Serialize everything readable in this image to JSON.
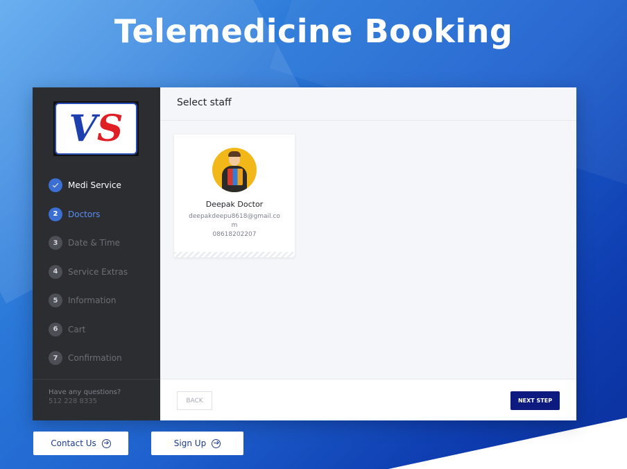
{
  "page": {
    "title": "Telemedicine Booking"
  },
  "logo": {
    "letters": "VS"
  },
  "sidebar": {
    "steps": [
      {
        "num": "1",
        "label": "Medi Service",
        "state": "done"
      },
      {
        "num": "2",
        "label": "Doctors",
        "state": "active"
      },
      {
        "num": "3",
        "label": "Date & Time",
        "state": "pending"
      },
      {
        "num": "4",
        "label": "Service Extras",
        "state": "pending"
      },
      {
        "num": "5",
        "label": "Information",
        "state": "pending"
      },
      {
        "num": "6",
        "label": "Cart",
        "state": "pending"
      },
      {
        "num": "7",
        "label": "Confirmation",
        "state": "pending"
      }
    ],
    "footer": {
      "question": "Have any questions?",
      "phone": "512 228 8335"
    }
  },
  "content": {
    "header": "Select staff",
    "staff": [
      {
        "name": "Deepak Doctor",
        "email": "deepakdeepu8618@gmail.com",
        "phone": "08618202207"
      }
    ]
  },
  "footer": {
    "back_label": "BACK",
    "next_label": "NEXT STEP"
  },
  "cta": {
    "contact_label": "Contact Us",
    "signup_label": "Sign Up"
  },
  "colors": {
    "accent": "#3b6fd4",
    "primary_button": "#0d1a80",
    "sidebar_bg": "#2b2d31"
  }
}
